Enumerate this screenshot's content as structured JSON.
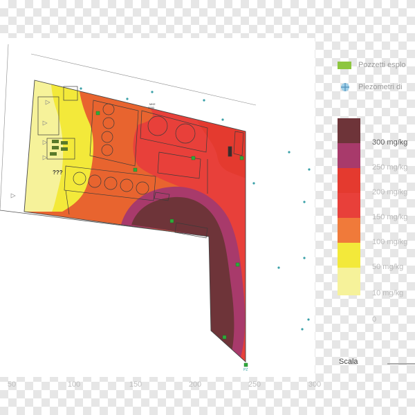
{
  "legend": {
    "items": [
      {
        "label": "Pozzetti esplo",
        "icon": "green-square-icon",
        "color": "#8dc63f"
      },
      {
        "label": "Piezometri di",
        "icon": "blue-piezometer-icon",
        "color": "#6fb3d9"
      }
    ]
  },
  "scale": {
    "title": "Scala",
    "levels": [
      {
        "label": "300 mg/kg",
        "color": "#6e3439",
        "faded": false
      },
      {
        "label": "250 mg/kg",
        "color": "#a83a6b",
        "faded": true
      },
      {
        "label": "200 mg/kg",
        "color": "#e43a2f",
        "faded": true
      },
      {
        "label": "150 mg/kg",
        "color": "#e8403a",
        "faded": true
      },
      {
        "label": "100 mg/kg",
        "color": "#f07a3a",
        "faded": true
      },
      {
        "label": "50 mg/kg",
        "color": "#f3e93a",
        "faded": true
      },
      {
        "label": "10 mg/kg",
        "color": "#f6f29a",
        "faded": true
      }
    ],
    "zero_label": "0"
  },
  "axis_ticks": [
    "50",
    "100",
    "150",
    "200",
    "250",
    "300"
  ],
  "map": {
    "unknown_label": "???",
    "top_label_1": "MKE",
    "top_label_2": "0000",
    "bottom_point_label": "PZ"
  }
}
